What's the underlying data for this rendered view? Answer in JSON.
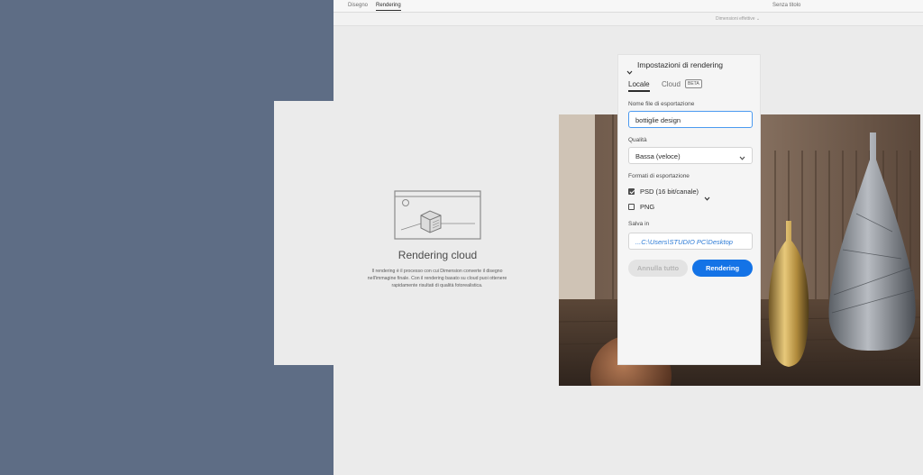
{
  "topbar": {
    "tabs": [
      {
        "label": "Disegno",
        "active": false
      },
      {
        "label": "Rendering",
        "active": true
      }
    ],
    "doc_title": "Senza titolo"
  },
  "subbar": {
    "dimensions_label": "Dimensioni effettive"
  },
  "cloud_panel": {
    "title": "Rendering cloud",
    "description": "Il rendering è il processo con cui Dimension converte il disegno nell'immagine finale. Con il rendering basato su cloud puoi ottenere rapidamente risultati di qualità fotorealistica."
  },
  "settings": {
    "header": "Impostazioni di rendering",
    "tabs": {
      "locale": "Locale",
      "cloud": "Cloud",
      "beta_badge": "BETA"
    },
    "filename_label": "Nome file di esportazione",
    "filename_value": "bottiglie design",
    "quality_label": "Qualità",
    "quality_value": "Bassa (veloce)",
    "formats_label": "Formati di esportazione",
    "formats": [
      {
        "label": "PSD (16 bit/canale)",
        "checked": true,
        "has_dropdown": true
      },
      {
        "label": "PNG",
        "checked": false,
        "has_dropdown": false
      }
    ],
    "save_label": "Salva in",
    "save_path": "...C:\\Users\\STUDIO PC\\Desktop",
    "cancel_all": "Annulla tutto",
    "render_button": "Rendering"
  },
  "colors": {
    "accent": "#1473e6",
    "path_link": "#2b7ad6",
    "outer_background": "#5e6d85",
    "focus_border": "#4b9af0"
  },
  "icons": [
    "collapse-chevron-icon",
    "dropdown-chevron-icon",
    "cloud-render-illustration-icon"
  ]
}
